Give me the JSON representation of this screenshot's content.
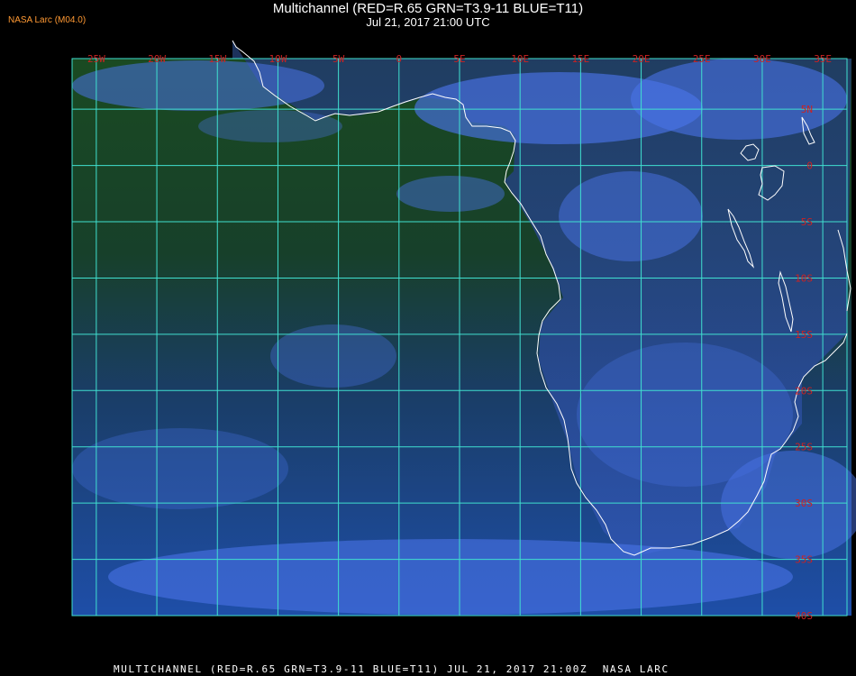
{
  "header": {
    "corner_tag": "NASA Larc (M04.0)",
    "title": "Multichannel (RED=R.65 GRN=T3.9-11 BLUE=T11)",
    "subtitle": "Jul 21, 2017 21:00 UTC"
  },
  "footer": {
    "text": "MULTICHANNEL (RED=R.65 GRN=T3.9-11 BLUE=T11) JUL 21, 2017 21:00Z  NASA LARC"
  },
  "map": {
    "extent": {
      "lon_min": -27,
      "lon_max": 37,
      "lat_max": 9.5,
      "lat_min": -40
    },
    "longitude_labels": [
      {
        "lon": -25,
        "text": "25W"
      },
      {
        "lon": -20,
        "text": "20W"
      },
      {
        "lon": -15,
        "text": "15W"
      },
      {
        "lon": -10,
        "text": "10W"
      },
      {
        "lon": -5,
        "text": "5W"
      },
      {
        "lon": 0,
        "text": "0"
      },
      {
        "lon": 5,
        "text": "5E"
      },
      {
        "lon": 10,
        "text": "10E"
      },
      {
        "lon": 15,
        "text": "15E"
      },
      {
        "lon": 20,
        "text": "20E"
      },
      {
        "lon": 25,
        "text": "25E"
      },
      {
        "lon": 30,
        "text": "30E"
      },
      {
        "lon": 35,
        "text": "35E"
      }
    ],
    "latitude_labels": [
      {
        "lat": 5,
        "text": "5N"
      },
      {
        "lat": 0,
        "text": "0"
      },
      {
        "lat": -5,
        "text": "5S"
      },
      {
        "lat": -10,
        "text": "10S"
      },
      {
        "lat": -15,
        "text": "15S"
      },
      {
        "lat": -20,
        "text": "20S"
      },
      {
        "lat": -25,
        "text": "25S"
      },
      {
        "lat": -30,
        "text": "30S"
      },
      {
        "lat": -35,
        "text": "35S"
      },
      {
        "lat": -40,
        "text": "40S"
      }
    ],
    "colors": {
      "ocean": "#12366e",
      "land": "#1a3a1a",
      "cloud": "#4a73e8",
      "grid": "#40e0d0",
      "coast": "#ffffff",
      "label": "#cc2222"
    }
  }
}
